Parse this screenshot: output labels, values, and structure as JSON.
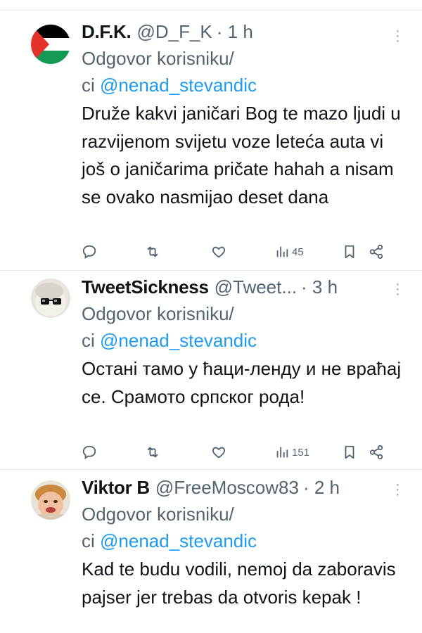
{
  "tweets": [
    {
      "name": "D.F.K.",
      "handle": "@D_F_K",
      "time": "· 1 h",
      "reply_prefix": "Odgovor korisniku/",
      "reply_suffix": "ci",
      "mention": "@nenad_stevandic",
      "text": "Druže kakvi janičari Bog te mazo ljudi u razvijenom svijetu voze leteća auta vi još o janičarima pričate hahah a nisam se ovako nasmijao deset dana",
      "views": "45",
      "avatar_icon": "palestine-flag-avatar"
    },
    {
      "name": "TweetSickness",
      "handle": "@Tweet...",
      "time": "· 3 h",
      "reply_prefix": "Odgovor korisniku/",
      "reply_suffix": "ci",
      "mention": "@nenad_stevandic",
      "text": "Останi тамо у ћаци-ленду и не враћај се. Срамото српског рода!",
      "views": "151",
      "avatar_icon": "glasses-avatar"
    },
    {
      "name": "Viktor B",
      "handle": "@FreeMoscow83",
      "time": "· 2 h",
      "reply_prefix": "Odgovor korisniku/",
      "reply_suffix": "ci",
      "mention": "@nenad_stevandic",
      "text": "Kad te budu vodili, nemoj da zaboravis pajser jer trebas da otvoris kepak !",
      "views": "",
      "avatar_icon": "child-face-avatar"
    }
  ],
  "colors": {
    "accent": "#1d9bf0",
    "secondary": "#536471",
    "text": "#0f1419",
    "divider": "#e7e9ea"
  }
}
